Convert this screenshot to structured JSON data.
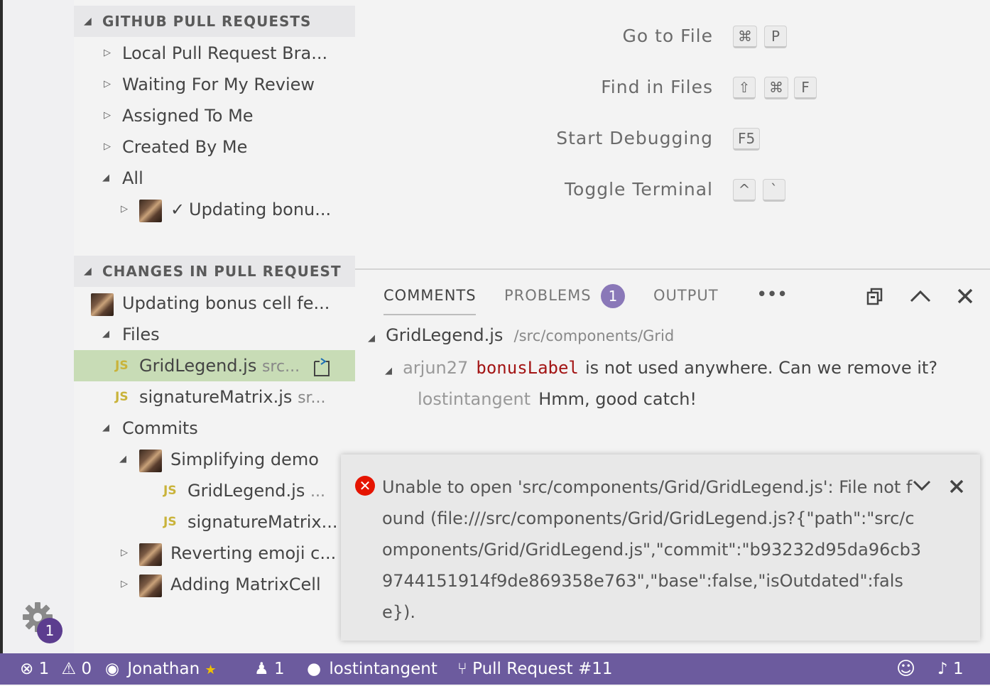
{
  "sidebar": {
    "github_section": {
      "title": "GITHUB PULL REQUESTS",
      "items": [
        {
          "label": "Local Pull Request Bra..."
        },
        {
          "label": "Waiting For My Review"
        },
        {
          "label": "Assigned To Me"
        },
        {
          "label": "Created By Me"
        },
        {
          "label": "All"
        }
      ],
      "pr_item": {
        "check": "✓",
        "label": "Updating bonu..."
      }
    },
    "changes_section": {
      "title": "CHANGES IN PULL REQUEST",
      "pr_title": "Updating bonus cell fe...",
      "files_label": "Files",
      "files": [
        {
          "icon": "JS",
          "name": "GridLegend.js",
          "desc": "src..."
        },
        {
          "icon": "JS",
          "name": "signatureMatrix.js",
          "desc": "sr..."
        }
      ],
      "commits_label": "Commits",
      "commits": [
        {
          "label": "Simplifying demo",
          "files": [
            {
              "icon": "JS",
              "name": "GridLegend.js",
              "desc": "..."
            },
            {
              "icon": "JS",
              "name": "signatureMatrix..."
            }
          ]
        },
        {
          "label": "Reverting emoji c..."
        },
        {
          "label": "Adding MatrixCell"
        }
      ]
    }
  },
  "activity": {
    "gear_badge": "1"
  },
  "shortcuts": [
    {
      "label": "Go to File",
      "keys": [
        "⌘",
        "P"
      ]
    },
    {
      "label": "Find in Files",
      "keys": [
        "⇧",
        "⌘",
        "F"
      ]
    },
    {
      "label": "Start Debugging",
      "keys": [
        "F5"
      ]
    },
    {
      "label": "Toggle Terminal",
      "keys": [
        "^",
        "`"
      ]
    }
  ],
  "panel": {
    "tabs": {
      "comments": "COMMENTS",
      "problems": "PROBLEMS",
      "output": "OUTPUT",
      "more": "•••"
    },
    "problems_count": "1",
    "file": {
      "name": "GridLegend.js",
      "path": "/src/components/Grid"
    },
    "comment": {
      "author": "arjun27",
      "code": "bonusLabel",
      "text": "is not used anywhere. Can we remove it?"
    },
    "reply": {
      "author": "lostintangent",
      "text": "Hmm, good catch!"
    }
  },
  "notification": {
    "message": "Unable to open 'src/components/Grid/GridLegend.js': File not found (file:///src/components/Grid/GridLegend.js?{\"path\":\"src/components/Grid/GridLegend.js\",\"commit\":\"b93232d95da96cb39744151914f9de869358e763\",\"base\":false,\"isOutdated\":false})."
  },
  "statusbar": {
    "errors": "1",
    "warnings": "0",
    "user": "Jonathan",
    "participants": "1",
    "github_user": "lostintangent",
    "branch": "Pull Request #11",
    "notifications": "1"
  },
  "colors": {
    "statusbar": "#6c5b9e",
    "selection": "#c8dcb6",
    "badge": "#8a78b8",
    "error": "#e51400"
  }
}
